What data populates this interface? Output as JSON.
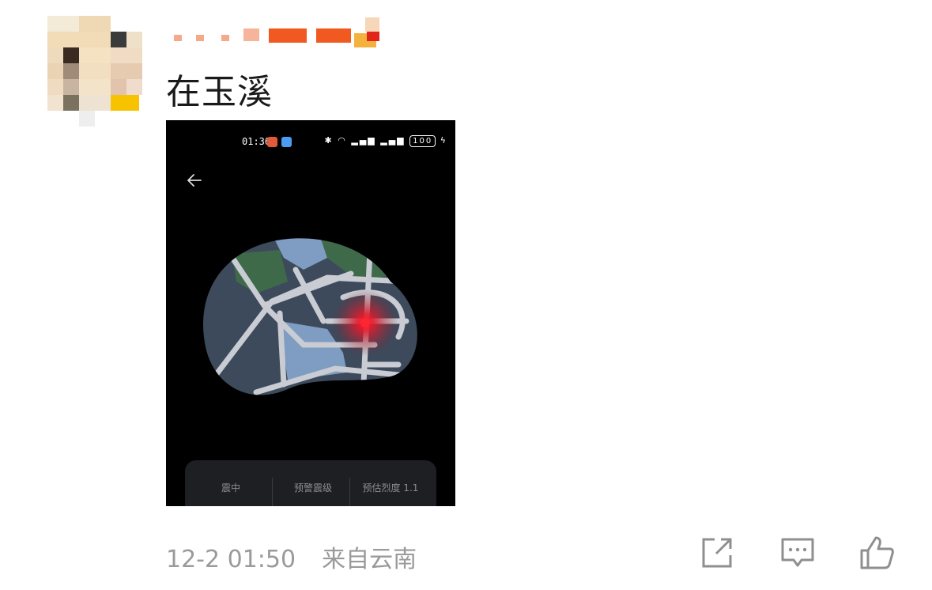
{
  "post": {
    "text": "在玉溪",
    "date": "12-2 01:50",
    "source": "来自云南"
  },
  "screenshot": {
    "status_time": "01:36",
    "battery": "100",
    "info_labels": [
      "震中",
      "预警震级",
      "预估烈度 1.1"
    ]
  },
  "icons": {
    "back": "arrow-left-icon",
    "share": "share-icon",
    "comment": "comment-icon",
    "like": "thumbs-up-icon"
  },
  "colors": {
    "meta_text": "#9a9a9a",
    "map_land": "#3d4a5c",
    "map_water": "#7f9cc2",
    "map_park": "#3e6a4a",
    "epicenter": "#e21b2d"
  }
}
